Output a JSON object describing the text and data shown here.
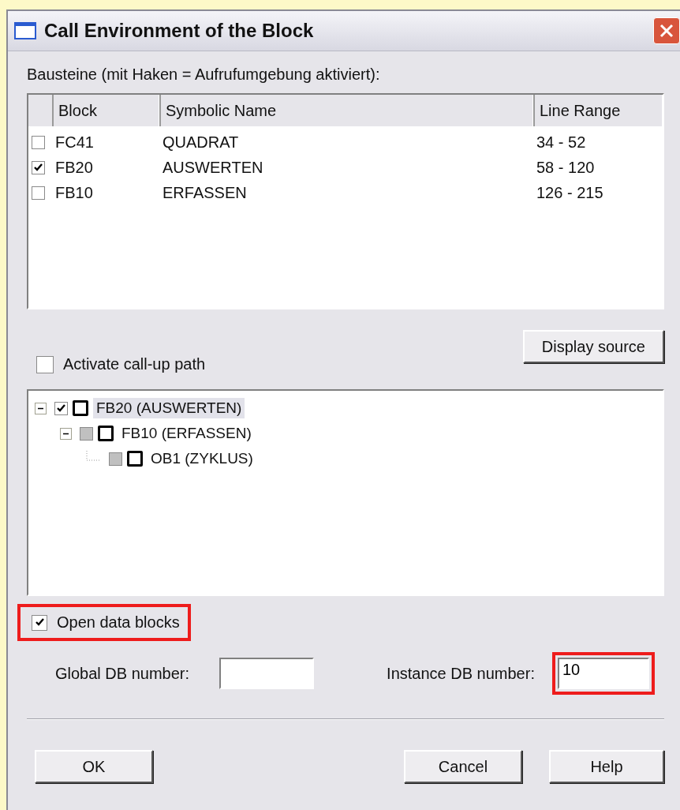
{
  "window": {
    "title": "Call Environment of the Block"
  },
  "blocks_label": "Bausteine (mit Haken = Aufrufumgebung aktiviert):",
  "table": {
    "columns": [
      "Block",
      "Symbolic Name",
      "Line Range"
    ],
    "rows": [
      {
        "checked": false,
        "cells": [
          "FC41",
          "QUADRAT",
          "34 - 52"
        ]
      },
      {
        "checked": true,
        "cells": [
          "FB20",
          "AUSWERTEN",
          "58 - 120"
        ]
      },
      {
        "checked": false,
        "cells": [
          "FB10",
          "ERFASSEN",
          "126 - 215"
        ]
      }
    ]
  },
  "display_source_button": "Display source",
  "activate_call_path": {
    "label": "Activate call-up path",
    "checked": false
  },
  "tree": [
    {
      "label": "FB20 (AUSWERTEN)",
      "checked": true,
      "disabled": false,
      "selected": true,
      "expanded": true,
      "children": [
        {
          "label": "FB10 (ERFASSEN)",
          "checked": false,
          "disabled": true,
          "selected": false,
          "expanded": true,
          "children": [
            {
              "label": "OB1 (ZYKLUS)",
              "checked": false,
              "disabled": true,
              "selected": false
            }
          ]
        }
      ]
    }
  ],
  "open_data_blocks": {
    "label": "Open data blocks",
    "checked": true,
    "highlighted": true
  },
  "global_db": {
    "label": "Global DB number:"
  },
  "instance_db": {
    "label": "Instance DB number:",
    "value": "10",
    "highlighted": true
  },
  "buttons": [
    "OK",
    "Cancel",
    "Help"
  ]
}
